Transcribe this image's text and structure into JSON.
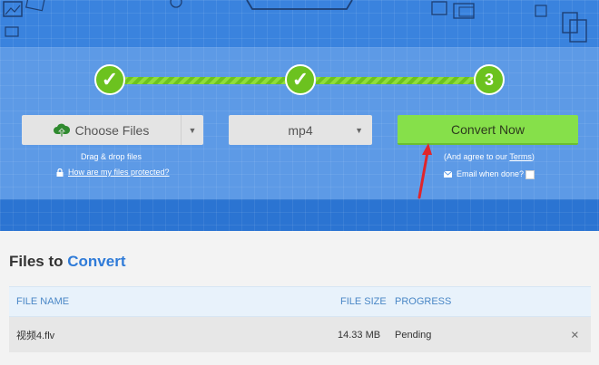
{
  "steps": [
    {
      "label": "✓",
      "state": "done"
    },
    {
      "label": "✓",
      "state": "done"
    },
    {
      "label": "3",
      "state": "current"
    }
  ],
  "upload": {
    "choose_label": "Choose Files",
    "drag_hint": "Drag & drop files",
    "protected_link": "How are my files protected?"
  },
  "format": {
    "selected": "mp4"
  },
  "convert": {
    "button_label": "Convert Now",
    "agree_prefix": "(And agree to our ",
    "terms_link": "Terms",
    "agree_suffix": ")",
    "email_label": "Email when done?"
  },
  "files": {
    "title_prefix": "Files to",
    "title_accent": "Convert",
    "columns": {
      "name": "FILE NAME",
      "size": "FILE SIZE",
      "progress": "PROGRESS"
    },
    "rows": [
      {
        "name": "视频4.flv",
        "size": "14.33 MB",
        "status": "Pending",
        "remove": "×"
      }
    ]
  },
  "colors": {
    "accent_blue": "#2f7bd8",
    "step_green": "#6cc21f",
    "convert_green": "#86e04a",
    "annotation_red": "#e0252b"
  }
}
